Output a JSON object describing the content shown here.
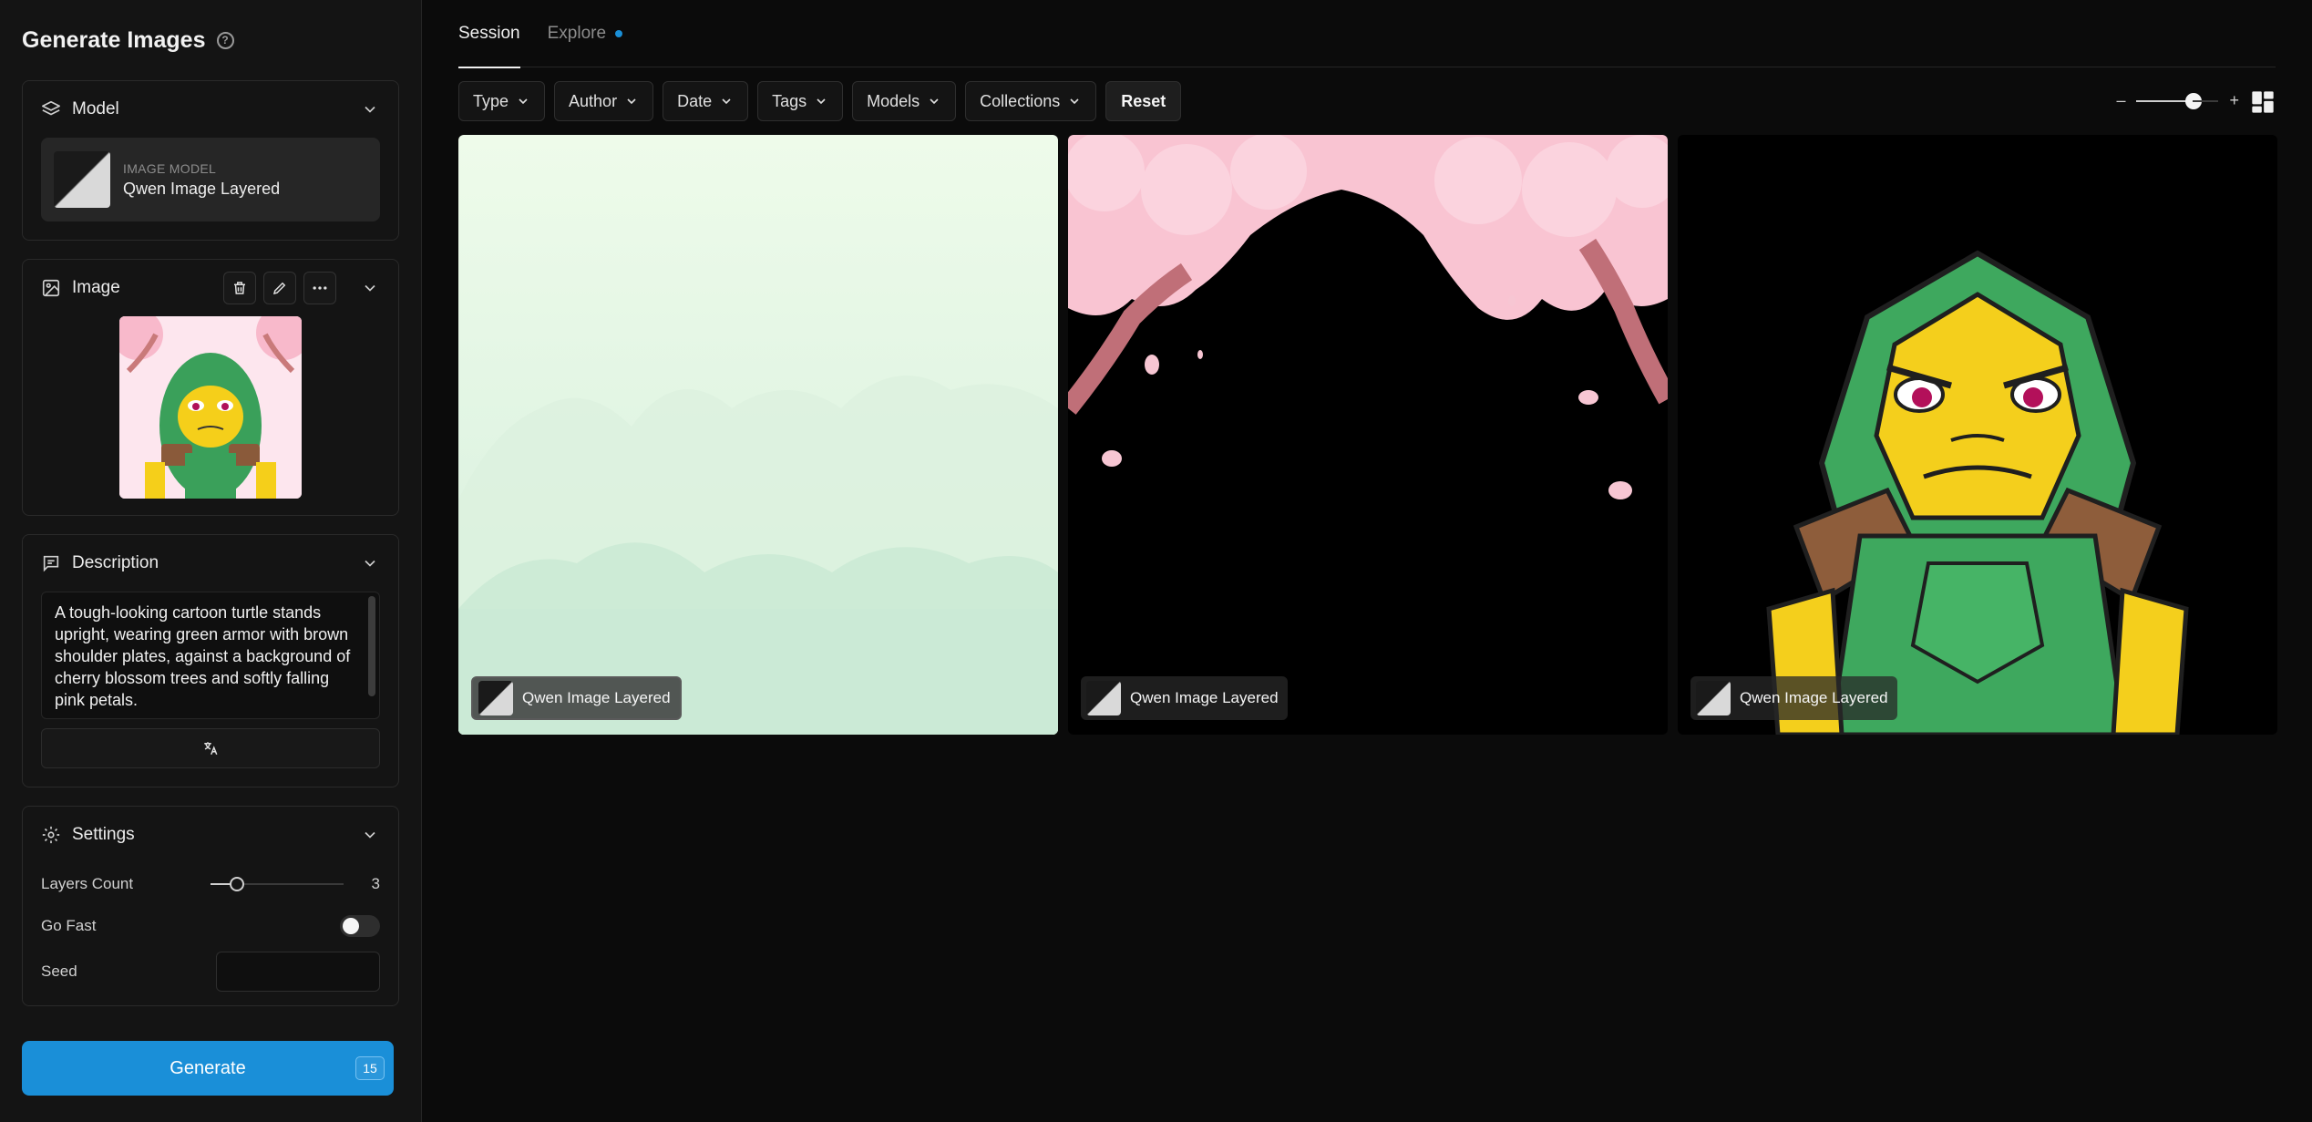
{
  "sidebar": {
    "title": "Generate Images",
    "model_panel": {
      "title": "Model",
      "card_label": "IMAGE MODEL",
      "card_name": "Qwen Image Layered"
    },
    "image_panel": {
      "title": "Image"
    },
    "description_panel": {
      "title": "Description",
      "text": "A tough-looking cartoon turtle stands upright, wearing green armor with brown shoulder plates, against a background of cherry blossom trees and softly falling pink petals."
    },
    "settings_panel": {
      "title": "Settings",
      "layers_label": "Layers Count",
      "layers_value": "3",
      "layers_level": 0.2,
      "go_fast_label": "Go Fast",
      "go_fast_on": false,
      "seed_label": "Seed",
      "seed_value": ""
    },
    "generate": {
      "label": "Generate",
      "badge": "15"
    }
  },
  "main": {
    "tabs": [
      {
        "label": "Session",
        "active": true
      },
      {
        "label": "Explore",
        "active": false,
        "has_dot": true
      }
    ],
    "filters": [
      "Type",
      "Author",
      "Date",
      "Tags",
      "Models",
      "Collections"
    ],
    "reset_label": "Reset",
    "zoom": {
      "minus": "–",
      "plus": "+",
      "level": 0.7
    },
    "results": [
      {
        "model": "Qwen Image Layered",
        "content": "layer-background"
      },
      {
        "model": "Qwen Image Layered",
        "content": "layer-cherry-blossoms"
      },
      {
        "model": "Qwen Image Layered",
        "content": "layer-turtle"
      }
    ]
  },
  "colors": {
    "accent": "#1a8fd8",
    "bg": "#0b0b0b",
    "panel": "#141414"
  }
}
